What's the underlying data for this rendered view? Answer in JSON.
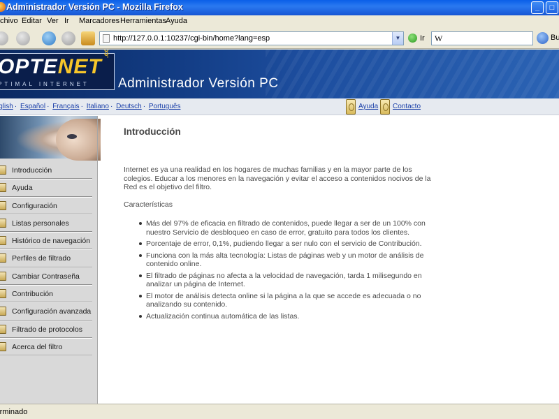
{
  "window": {
    "title": "Administrador Versión PC - Mozilla Firefox"
  },
  "menubar": [
    "Archivo",
    "Editar",
    "Ver",
    "Ir",
    "Marcadores",
    "Herramientas",
    "Ayuda"
  ],
  "navbar": {
    "url": "http://127.0.0.1:10237/cgi-bin/home?lang=esp",
    "go_label": "Ir",
    "search_engine": "W",
    "search_button_label": "Bu"
  },
  "banner": {
    "logo_left": "OPTE",
    "logo_right": "NET",
    "logo_domain": ".com",
    "logo_tagline": "PTIMAL INTERNET",
    "title": "Administrador Versión PC"
  },
  "langbar": {
    "languages": [
      "English",
      "Español",
      "Français",
      "Italiano",
      "Deutsch",
      "Português"
    ],
    "help_link": "Ayuda",
    "contact_link": "Contacto"
  },
  "sidebar": {
    "items": [
      "Introducción",
      "Ayuda",
      "Configuración",
      "Listas personales",
      "Histórico de navegación",
      "Perfiles de filtrado",
      "Cambiar Contraseña",
      "Contribución",
      "Configuración avanzada",
      "Filtrado de protocolos",
      "Acerca del filtro"
    ]
  },
  "main": {
    "heading": "Introducción",
    "intro": "Internet es ya una realidad en los hogares de muchas familias y en la mayor parte de los colegios. Educar a los menores en la navegación y evitar el acceso a contenidos nocivos de la Red es el objetivo del filtro.",
    "features_title": "Características",
    "features": [
      "Más del 97% de eficacia en filtrado de contenidos, puede llegar a ser de un 100% con nuestro Servicio de desbloqueo en caso de error, gratuito para todos los clientes.",
      "Porcentaje de error, 0,1%, pudiendo llegar a ser nulo con el servicio de Contribución.",
      "Funciona con la más alta tecnología: Listas de páginas web y un motor de análisis de contenido online.",
      "El filtrado de páginas no afecta a la velocidad de navegación, tarda 1 milisegundo en analizar un página de Internet.",
      "El motor de análisis detecta online si la página a la que se accede es adecuada o no analizando su contenido.",
      "Actualización continua automática de las listas."
    ]
  },
  "statusbar": {
    "text": "Terminado"
  }
}
